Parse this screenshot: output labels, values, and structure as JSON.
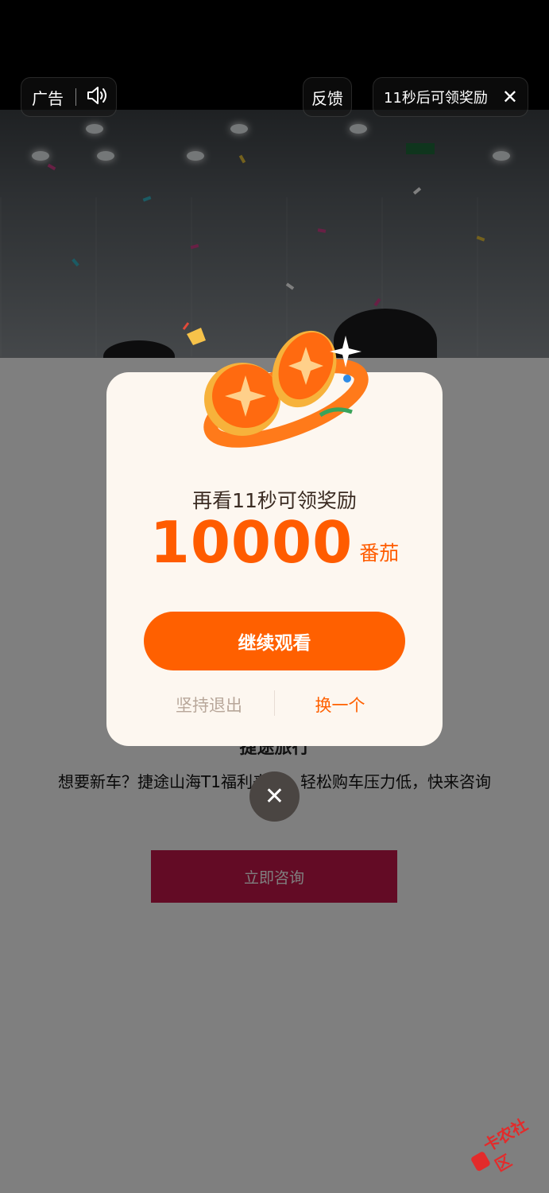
{
  "top_bar": {
    "ad_label": "广告",
    "feedback_label": "反馈",
    "reward_countdown": "11秒后可领奖励"
  },
  "ad": {
    "brand_title": "捷途旅行",
    "description": "想要新车？捷途山海T1福利来袭，轻松购车压力低，快来咨询",
    "cta_label": "立即咨询"
  },
  "modal": {
    "subtitle": "再看11秒可领奖励",
    "amount": "10000",
    "unit": "番茄",
    "continue_label": "继续观看",
    "quit_label": "坚持退出",
    "swap_label": "换一个"
  },
  "watermark": {
    "text": "卡农社区"
  },
  "colors": {
    "accent": "#ff6000",
    "cta_red": "#c6174a",
    "modal_bg": "#fdf7f0"
  }
}
